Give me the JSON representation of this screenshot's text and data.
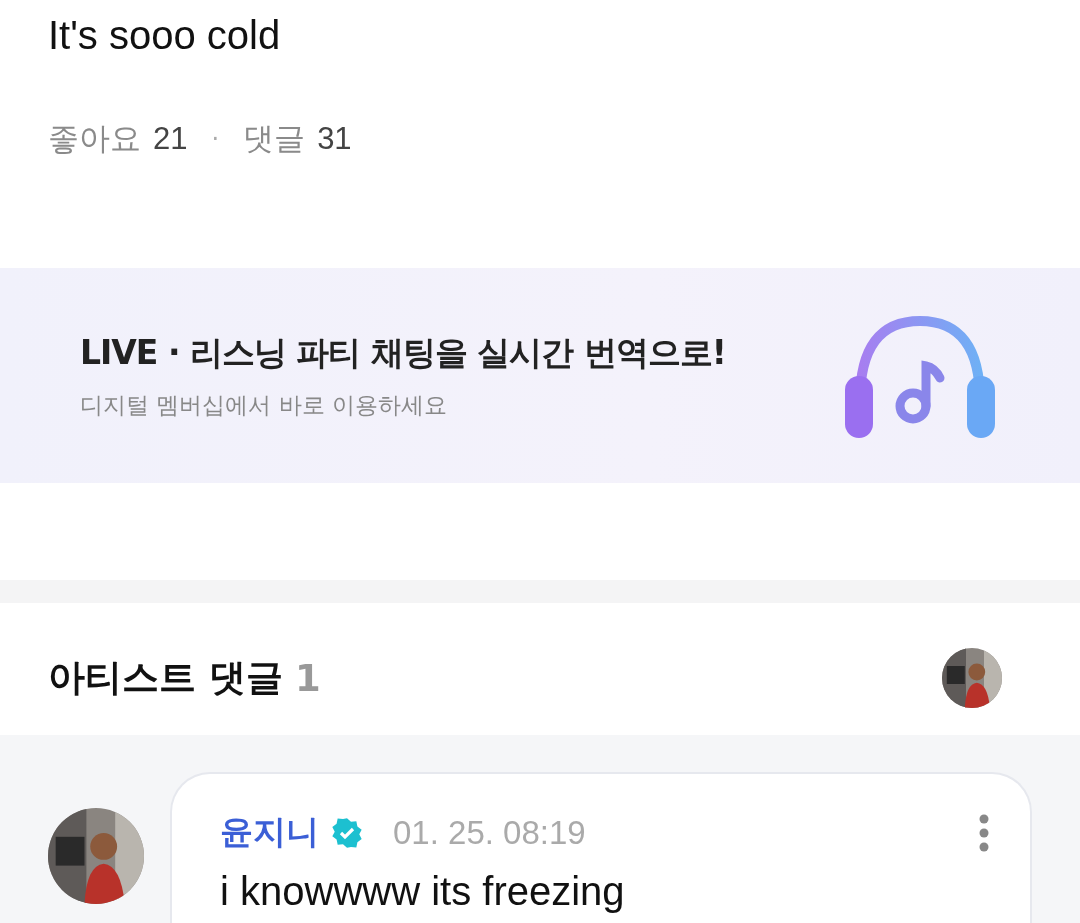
{
  "post": {
    "text": "It's sooo cold",
    "likes_label": "좋아요",
    "likes_count": "21",
    "separator": "·",
    "comments_label": "댓글",
    "comments_count": "31"
  },
  "banner": {
    "title": "LIVE · 리스닝 파티 채팅을 실시간 번역으로!",
    "subtitle": "디지털 멤버십에서 바로 이용하세요"
  },
  "artist_comments": {
    "title": "아티스트 댓글",
    "count": "1",
    "comments": [
      {
        "name": "윤지니",
        "verified": true,
        "time": "01. 25. 08:19",
        "text": "i knowwww its freezing"
      }
    ]
  }
}
